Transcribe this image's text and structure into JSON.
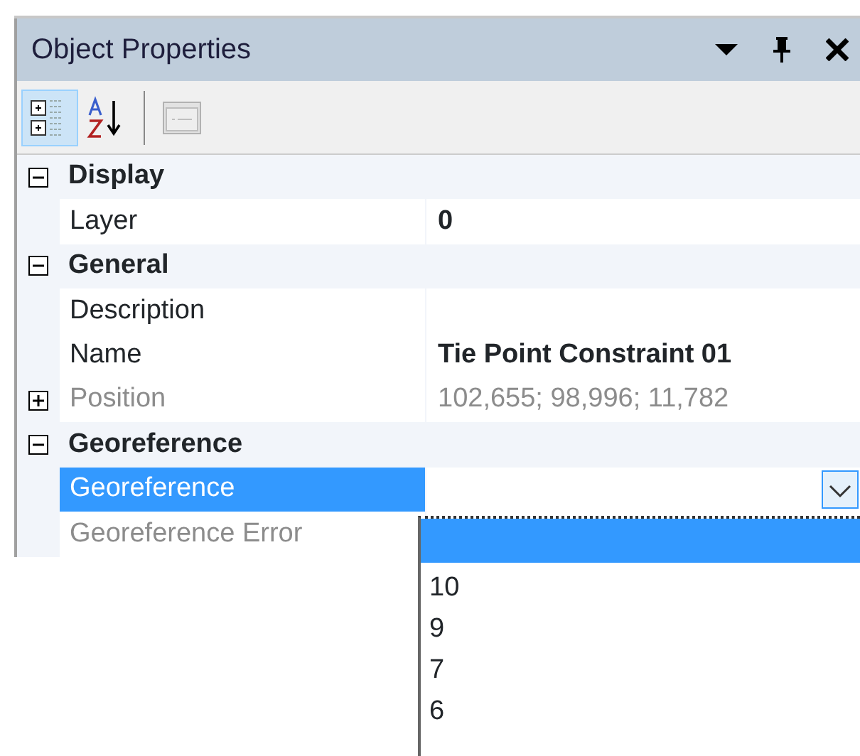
{
  "panel": {
    "title": "Object Properties"
  },
  "toolbar": [
    {
      "kind": "categorized",
      "selected": true,
      "disabled": false
    },
    {
      "kind": "alphabetical",
      "selected": false,
      "disabled": false
    },
    {
      "kind": "pages",
      "selected": false,
      "disabled": true
    }
  ],
  "categories": [
    {
      "name": "Display",
      "expanded": true,
      "properties": [
        {
          "name": "Layer",
          "value": "0",
          "bold": true,
          "readonly": false,
          "selected": false
        }
      ]
    },
    {
      "name": "General",
      "expanded": true,
      "properties": [
        {
          "name": "Description",
          "readonly": false,
          "selected": false
        },
        {
          "name": "Name",
          "value": "Tie Point Constraint 01",
          "bold": true,
          "readonly": false,
          "selected": false
        },
        {
          "name": "Position",
          "value": "102,655; 98,996; 11,782",
          "bold": false,
          "readonly": true,
          "selected": false,
          "expandable": true
        }
      ]
    },
    {
      "name": "Georeference",
      "expanded": true,
      "properties": [
        {
          "name": "Georeference",
          "readonly": false,
          "selected": true,
          "dropdown": true
        },
        {
          "name": "Georeference Error",
          "readonly": true,
          "selected": false
        }
      ]
    }
  ],
  "dropdown": {
    "items": [
      {
        "selected": true
      },
      {
        "label": "10",
        "selected": false
      },
      {
        "label": "9",
        "selected": false
      },
      {
        "label": "7",
        "selected": false
      },
      {
        "label": "6",
        "selected": false
      }
    ]
  }
}
